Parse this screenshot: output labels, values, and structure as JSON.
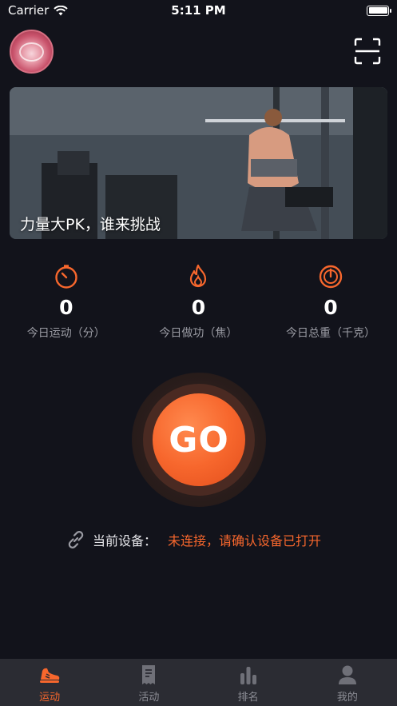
{
  "status_bar": {
    "carrier": "Carrier",
    "time": "5:11 PM"
  },
  "banner": {
    "caption": "力量大PK，谁来挑战"
  },
  "stats": [
    {
      "icon": "timer-icon",
      "value": "0",
      "label": "今日运动（分）"
    },
    {
      "icon": "flame-icon",
      "value": "0",
      "label": "今日做功（焦）"
    },
    {
      "icon": "gauge-icon",
      "value": "0",
      "label": "今日总重（千克）"
    }
  ],
  "go_button": {
    "label": "GO"
  },
  "device": {
    "label": "当前设备：",
    "status": "未连接，请确认设备已打开"
  },
  "tabs": [
    {
      "icon": "sneaker-icon",
      "label": "运动",
      "active": true
    },
    {
      "icon": "receipt-icon",
      "label": "活动",
      "active": false
    },
    {
      "icon": "bar-chart-icon",
      "label": "排名",
      "active": false
    },
    {
      "icon": "person-icon",
      "label": "我的",
      "active": false
    }
  ],
  "colors": {
    "accent": "#f7672d",
    "background": "#12131b",
    "tabbar": "#2b2c33",
    "muted": "#9a9ba3"
  }
}
